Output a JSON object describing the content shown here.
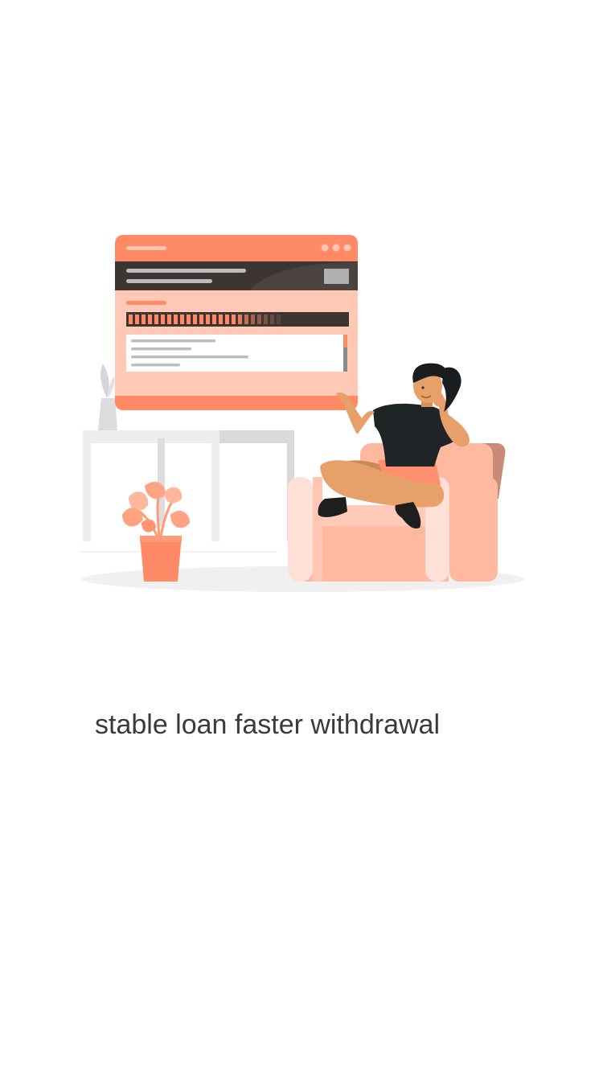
{
  "onboarding": {
    "caption": "stable loan faster withdrawal"
  },
  "palette": {
    "accent": "#ff8a65",
    "accent_light": "#ffc4b0",
    "dark": "#2e2e2e",
    "skin": "#e8a06a"
  }
}
